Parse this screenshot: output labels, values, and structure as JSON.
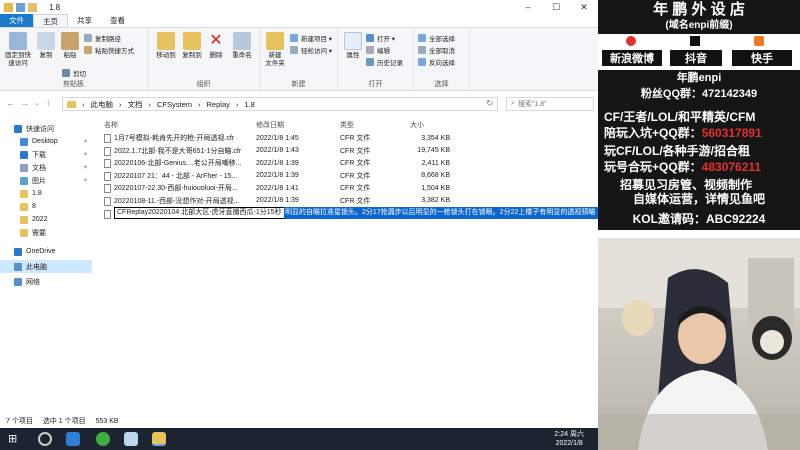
{
  "window": {
    "title": "1.8",
    "min": "–",
    "max": "☐",
    "close": "✕"
  },
  "tabs": [
    "文件",
    "主页",
    "共享",
    "查看"
  ],
  "ribbon": {
    "clipboard": {
      "pin_label": "固定到快\n速访问",
      "copy_label": "复制",
      "paste_label": "粘贴",
      "copy_path": "复制路径",
      "paste_shortcut": "粘贴快捷方式",
      "cut": "剪切",
      "group": "剪贴板"
    },
    "organize": {
      "move_to": "移动到",
      "copy_to": "复制到",
      "delete": "删除",
      "rename": "重命名",
      "group": "组织"
    },
    "new": {
      "new_folder": "新建\n文件夹",
      "new_item": "新建项目 ▾",
      "easy_access": "轻松访问 ▾",
      "group": "新建"
    },
    "open": {
      "properties": "属性",
      "open": "打开 ▾",
      "edit": "编辑",
      "history": "历史记录",
      "group": "打开"
    },
    "select": {
      "select_all": "全部选择",
      "select_none": "全部取消",
      "invert": "反向选择",
      "group": "选择"
    }
  },
  "address": {
    "path": [
      "此电脑",
      "文档",
      "CFSystem",
      "Replay",
      "1.8"
    ],
    "search_placeholder": "搜索\"1.8\""
  },
  "nav": [
    {
      "label": "快速访问",
      "color": "#2a78d0"
    },
    {
      "label": "Desktop",
      "color": "#3a8de0",
      "pin": true
    },
    {
      "label": "下载",
      "color": "#2a78d0",
      "pin": true
    },
    {
      "label": "文档",
      "color": "#8aa0b8",
      "pin": true
    },
    {
      "label": "图片",
      "color": "#5aa0d0",
      "pin": true
    },
    {
      "label": "1.8",
      "color": "#e8c25c"
    },
    {
      "label": "8",
      "color": "#e8c25c"
    },
    {
      "label": "2022",
      "color": "#e8c25c"
    },
    {
      "label": "需要",
      "color": "#e8c25c"
    },
    {
      "label": "OneDrive",
      "color": "#2a78d0"
    },
    {
      "label": "此电脑",
      "color": "#5a8fc8",
      "selected": true
    },
    {
      "label": "网络",
      "color": "#5a8fc8"
    }
  ],
  "columns": [
    "名称",
    "修改日期",
    "类型",
    "大小"
  ],
  "files": [
    {
      "name": "1月7号模拟-耗肯先开的枪-开局透视.cfr",
      "date": "2022/1/8 1:45",
      "type": "CFR 文件",
      "size": "3,354 KB"
    },
    {
      "name": "2022.1.7北部-我不是大哥651-1分自瞄.cfr",
      "date": "2022/1/8 1:43",
      "type": "CFR 文件",
      "size": "19,745 KB"
    },
    {
      "name": "20220106-北部-Genius....老公开局嘲移...",
      "date": "2022/1/8 1:39",
      "type": "CFR 文件",
      "size": "2,411 KB"
    },
    {
      "name": "20220107 21：44 - 北部 - ArFher - 15...",
      "date": "2022/1/8 1:39",
      "type": "CFR 文件",
      "size": "8,668 KB"
    },
    {
      "name": "20220107-22.30-西部-huiouoluoi-开局...",
      "date": "2022/1/8 1:41",
      "type": "CFR 文件",
      "size": "1,504 KB"
    },
    {
      "name": "20220108-11.-西部-没想作对-开局透视...",
      "date": "2022/1/8 1:39",
      "type": "CFR 文件",
      "size": "3,382 KB"
    }
  ],
  "rename_row": {
    "edit_text": "CFReplay20220104 北部大区-虎牙直播西瓜-1分15秒",
    "highlight_text": "明显的自瞄拉准星锁头。2分17抢漏步以后明显的一枪锁头打在锁眼。2分22上楼子有明显的透视预瞄"
  },
  "status": {
    "count": "7 个项目",
    "selected": "选中 1 个项目",
    "size": "553 KB"
  },
  "taskbar": {
    "time": "2:24 周六",
    "date": "2022/1/8"
  },
  "overlay": {
    "shop_title": "年 鹏 外 设 店",
    "shop_sub": "(域名enpi前缀)",
    "platforms": [
      "新浪微博",
      "抖音",
      "快手"
    ],
    "handle": "年鹏enpi",
    "qq_label": "粉丝QQ群：",
    "qq": "472142349",
    "line1": "CF/王者/LOL/和平精英/CFM",
    "line2_label": "陪玩入坑+QQ群：",
    "line2_num": "560317891",
    "line3": "玩CF/LOL/各种手游/招合租",
    "line4_label": "玩号合玩+QQ群：",
    "line4_num": "483076211",
    "line5": "招募见习房管、视频制作",
    "line6": "自媒体运营，详情见鱼吧",
    "kol_label": "KOL邀请码：",
    "kol_code": "ABC92224"
  }
}
